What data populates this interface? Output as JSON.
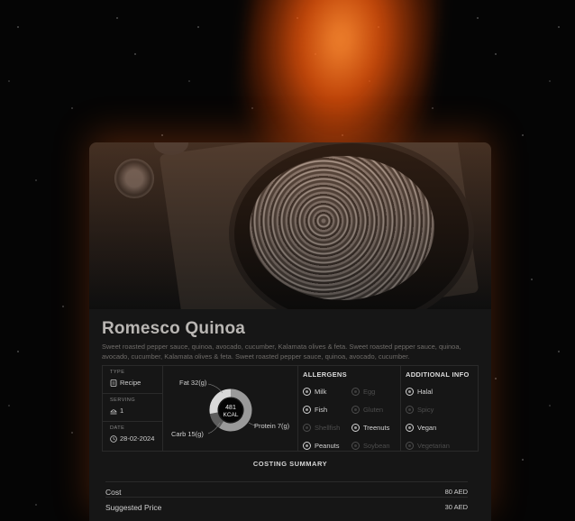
{
  "recipe": {
    "title": "Romesco Quinoa",
    "description": "Sweet roasted pepper sauce, quinoa, avocado, cucumber, Kalamata olives & feta. Sweet roasted pepper sauce, quinoa, avocado, cucumber, Kalamata olives & feta. Sweet roasted pepper sauce, quinoa, avocado, cucumber."
  },
  "meta": {
    "type_label": "TYPE",
    "type_value": "Recipe",
    "serving_label": "SERVING",
    "serving_value": "1",
    "date_label": "DATE",
    "date_value": "28-02-2024"
  },
  "nutrition": {
    "kcal_value": "481",
    "kcal_unit": "KCAL",
    "fat_label": "Fat 32(g)",
    "protein_label": "Protein 7(g)",
    "carb_label": "Carb 15(g)",
    "macros_g": {
      "fat": 32,
      "protein": 7,
      "carb": 15
    },
    "colors": {
      "fat": "#9a9a9a",
      "protein": "#5e5e5e",
      "carb": "#d9d9d9"
    }
  },
  "allergens": {
    "title": "ALLERGENS",
    "items": [
      {
        "label": "Milk",
        "active": true,
        "icon": "milk-icon"
      },
      {
        "label": "Egg",
        "active": false,
        "icon": "egg-icon"
      },
      {
        "label": "Fish",
        "active": true,
        "icon": "fish-icon"
      },
      {
        "label": "Gluten",
        "active": false,
        "icon": "gluten-icon"
      },
      {
        "label": "Shellfish",
        "active": false,
        "icon": "shellfish-icon"
      },
      {
        "label": "Treenuts",
        "active": true,
        "icon": "treenut-icon"
      },
      {
        "label": "Peanuts",
        "active": true,
        "icon": "peanut-icon"
      },
      {
        "label": "Soybean",
        "active": false,
        "icon": "soybean-icon"
      }
    ]
  },
  "additional_info": {
    "title": "ADDITIONAL INFO",
    "items": [
      {
        "label": "Halal",
        "active": true,
        "icon": "halal-icon"
      },
      {
        "label": "Spicy",
        "active": false,
        "icon": "spicy-icon"
      },
      {
        "label": "Vegan",
        "active": true,
        "icon": "vegan-icon"
      },
      {
        "label": "Vegetarian",
        "active": false,
        "icon": "vegetarian-icon"
      }
    ]
  },
  "costing": {
    "title": "COSTING SUMMARY",
    "cost_label": "Cost",
    "cost_value": "80 AED",
    "price_label": "Suggested Price",
    "price_value": "30 AED"
  }
}
